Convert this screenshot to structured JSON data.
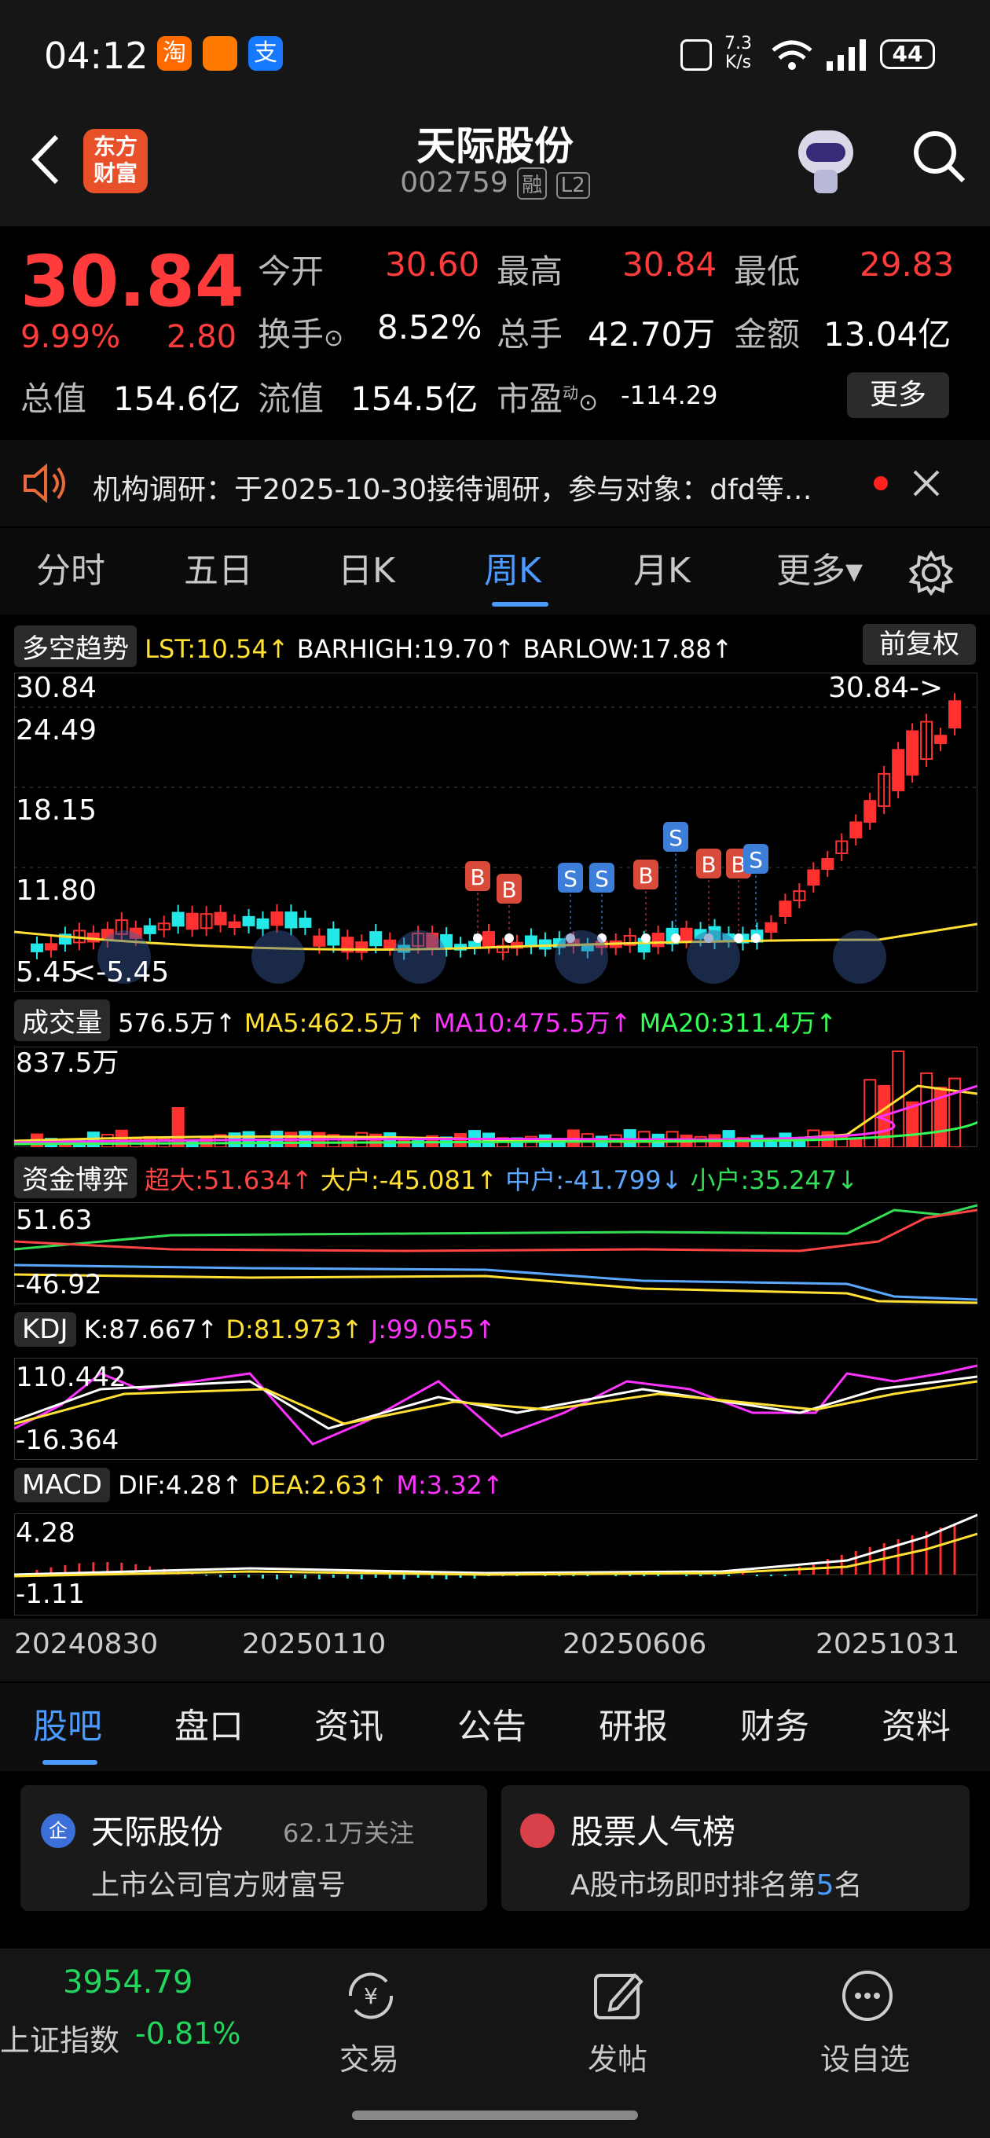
{
  "status_bar": {
    "time": "04:12",
    "app_icons": [
      "淘",
      "支"
    ],
    "speed": "7.3\nK/s",
    "speed_line1": "7.3",
    "speed_line2": "K/s",
    "battery": "44"
  },
  "header": {
    "title": "天际股份",
    "code": "002759",
    "badge_margin": "融",
    "badge_l2": "L2",
    "logo_line1": "东方",
    "logo_line2": "财富"
  },
  "quote": {
    "price": "30.84",
    "change_pct": "9.99%",
    "change": "2.80",
    "open_label": "今开",
    "open": "30.60",
    "high_label": "最高",
    "high": "30.84",
    "low_label": "最低",
    "low": "29.83",
    "turnover_label": "换手",
    "turnover": "8.52%",
    "volume_label": "总手",
    "volume": "42.70万",
    "amount_label": "金额",
    "amount": "13.04亿",
    "mktcap_label": "总值",
    "mktcap": "154.6亿",
    "float_label": "流值",
    "float": "154.5亿",
    "pe_label": "市盈",
    "pe_sup": "动",
    "pe": "-114.29",
    "more_button": "更多"
  },
  "notice": {
    "text": "机构调研：于2025-10-30接待调研，参与对象：dfd等…"
  },
  "chart_tabs": [
    "分时",
    "五日",
    "日K",
    "周K",
    "月K",
    "更多▾"
  ],
  "active_tab": "周K",
  "kline": {
    "indicator": "多空趋势",
    "values": [
      {
        "text": "LST:10.54↑",
        "color": "#ffe033"
      },
      {
        "text": "BARHIGH:19.70↑",
        "color": "#ffffff"
      },
      {
        "text": "BARLOW:17.88↑",
        "color": "#ffffff"
      }
    ],
    "adjust_button": "前复权",
    "axis": [
      "30.84",
      "24.49",
      "18.15",
      "11.80",
      "5.45"
    ],
    "low_marker": "<-5.45",
    "high_marker": "30.84->",
    "signals": [
      {
        "type": "B"
      },
      {
        "type": "B"
      },
      {
        "type": "S"
      },
      {
        "type": "S"
      },
      {
        "type": "B"
      },
      {
        "type": "S"
      },
      {
        "type": "B"
      },
      {
        "type": "B"
      },
      {
        "type": "S"
      }
    ]
  },
  "volume": {
    "indicator": "成交量",
    "values": [
      {
        "text": "576.5万↑",
        "color": "#ffffff"
      },
      {
        "text": "MA5:462.5万↑",
        "color": "#ffe033"
      },
      {
        "text": "MA10:475.5万↑",
        "color": "#ff33ff"
      },
      {
        "text": "MA20:311.4万↑",
        "color": "#33ff55"
      }
    ],
    "axis_top": "837.5万"
  },
  "capital": {
    "indicator": "资金博弈",
    "values": [
      {
        "text": "超大:51.634↑",
        "color": "#ff4444"
      },
      {
        "text": "大户:-45.081↑",
        "color": "#ffe033"
      },
      {
        "text": "中户:-41.799↓",
        "color": "#5aa8ff"
      },
      {
        "text": "小户:35.247↓",
        "color": "#33dd55"
      }
    ],
    "axis": [
      "51.63",
      "-46.92"
    ]
  },
  "kdj": {
    "indicator": "KDJ",
    "values": [
      {
        "text": "K:87.667↑",
        "color": "#ffffff"
      },
      {
        "text": "D:81.973↑",
        "color": "#ffe033"
      },
      {
        "text": "J:99.055↑",
        "color": "#ff33ff"
      }
    ],
    "axis": [
      "110.442",
      "-16.364"
    ]
  },
  "macd": {
    "indicator": "MACD",
    "values": [
      {
        "text": "DIF:4.28↑",
        "color": "#ffffff"
      },
      {
        "text": "DEA:2.63↑",
        "color": "#ffe033"
      },
      {
        "text": "M:3.32↑",
        "color": "#ff33ff"
      }
    ],
    "axis": [
      "4.28",
      "-1.11"
    ]
  },
  "x_dates": [
    "20240830",
    "20250110",
    "20250606",
    "20251031"
  ],
  "bottom_tabs": [
    "股吧",
    "盘口",
    "资讯",
    "公告",
    "研报",
    "财务",
    "资料"
  ],
  "cards": [
    {
      "title": "天际股份",
      "meta": "62.1万关注",
      "sub": "上市公司官方财富号"
    },
    {
      "title": "股票人气榜",
      "sub_pre": "A股市场即时排名第",
      "sub_num": "5",
      "sub_post": "名"
    }
  ],
  "footer": {
    "index_value": "3954.79",
    "index_name": "上证指数",
    "index_change": "-0.81%",
    "trade": "交易",
    "post": "发帖",
    "watchlist": "设自选"
  },
  "colors": {
    "up": "#ff3b3b",
    "down": "#22d65e",
    "accent": "#3d8bff"
  }
}
